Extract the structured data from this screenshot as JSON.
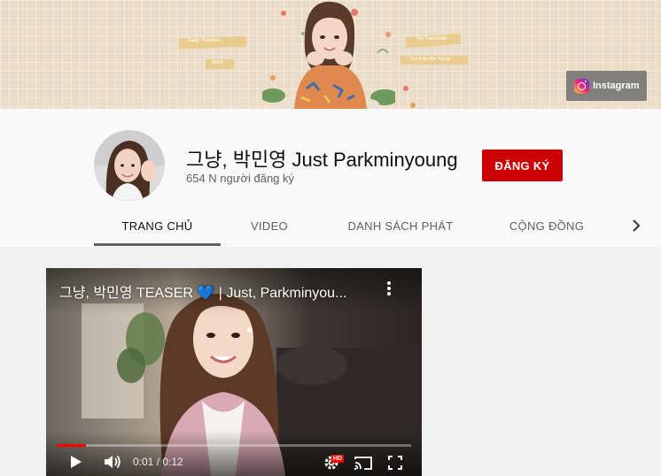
{
  "banner": {
    "insta_label": "Instagram",
    "tags": [
      "Daily Routine",
      "Work",
      "My Favourite",
      "Tips from Min Young"
    ]
  },
  "channel": {
    "name": "그냥, 박민영 Just Parkminyoung",
    "subscribers": "654 N người đăng ký",
    "subscribe_label": "ĐĂNG KÝ"
  },
  "tabs": [
    {
      "label": "TRANG CHỦ",
      "active": true
    },
    {
      "label": "VIDEO",
      "active": false
    },
    {
      "label": "DANH SÁCH PHÁT",
      "active": false
    },
    {
      "label": "CỘNG ĐỒNG",
      "active": false
    }
  ],
  "video": {
    "title": "그냥, 박민영 TEASER 💙 | Just, Parkminyou...",
    "current_time": "0:01",
    "duration": "0:12",
    "time_display": "0:01 / 0:12",
    "progress_fraction": 0.083,
    "hd_label": "HD"
  },
  "colors": {
    "subscribe": "#cc0000",
    "progress": "#ff0000",
    "banner_bg": "#eadcc6"
  },
  "icons": [
    "instagram-icon",
    "chevron-right-icon",
    "more-vert-icon",
    "play-icon",
    "volume-icon",
    "settings-icon",
    "cast-icon",
    "fullscreen-icon"
  ]
}
